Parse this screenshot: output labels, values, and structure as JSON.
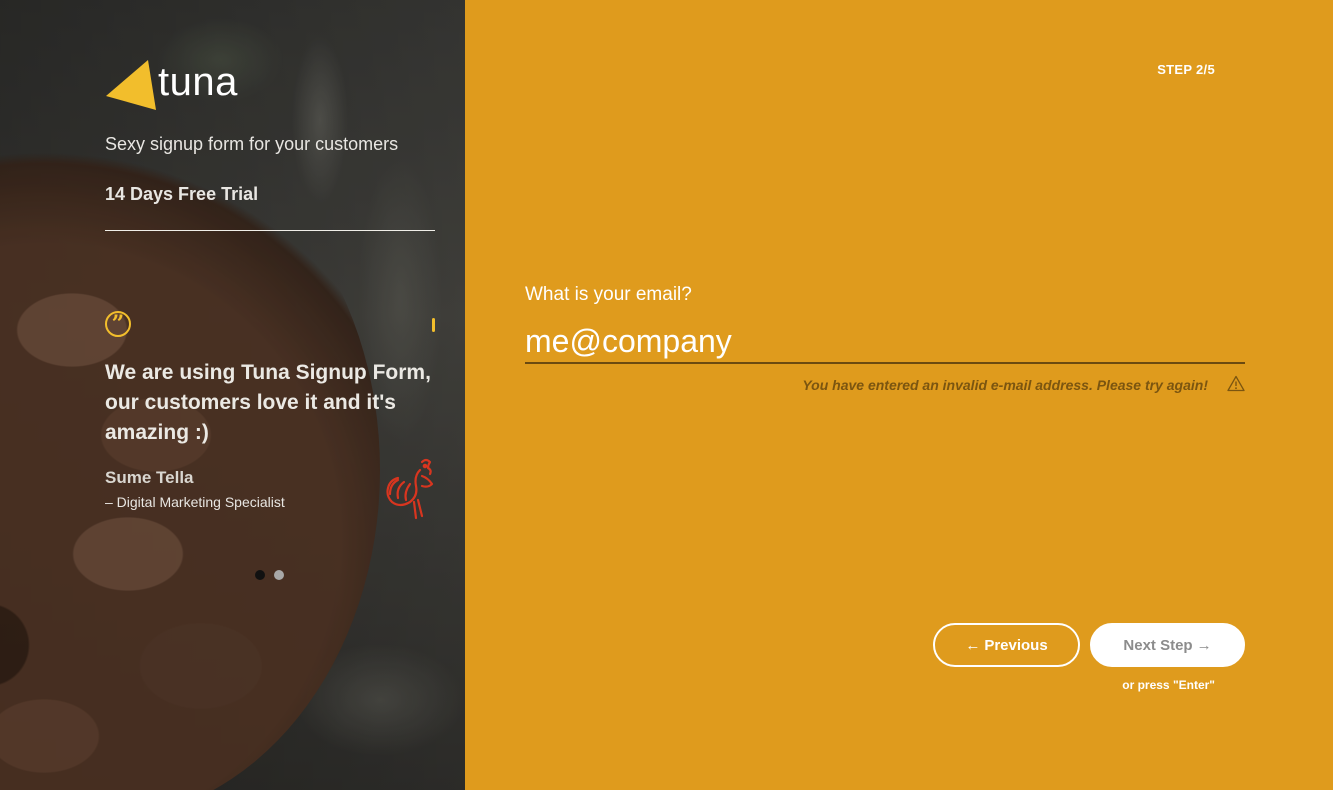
{
  "brand": {
    "name": "tuna",
    "accent": "#f2be2c"
  },
  "left_panel": {
    "tagline": "Sexy signup form for your customers",
    "trial": "14 Days Free Trial",
    "testimonial": {
      "quote": "We are using Tuna Signup Form, our customers love it and it's amazing :)",
      "author": "Sume Tella",
      "role": "– Digital Marketing Specialist",
      "quote_icon": "quote-icon",
      "company_icon": "rooster-icon"
    },
    "carousel": {
      "count": 2,
      "active": 1
    }
  },
  "form": {
    "step": "STEP 2/5",
    "question": "What is your email?",
    "email_value": "me@company",
    "error": "You have entered an invalid e-mail address. Please try again!",
    "warning_icon": "warning-icon",
    "previous_label": "Previous",
    "next_label": "Next Step",
    "hint": "or press \"Enter\"",
    "background": "#df9b1d"
  }
}
